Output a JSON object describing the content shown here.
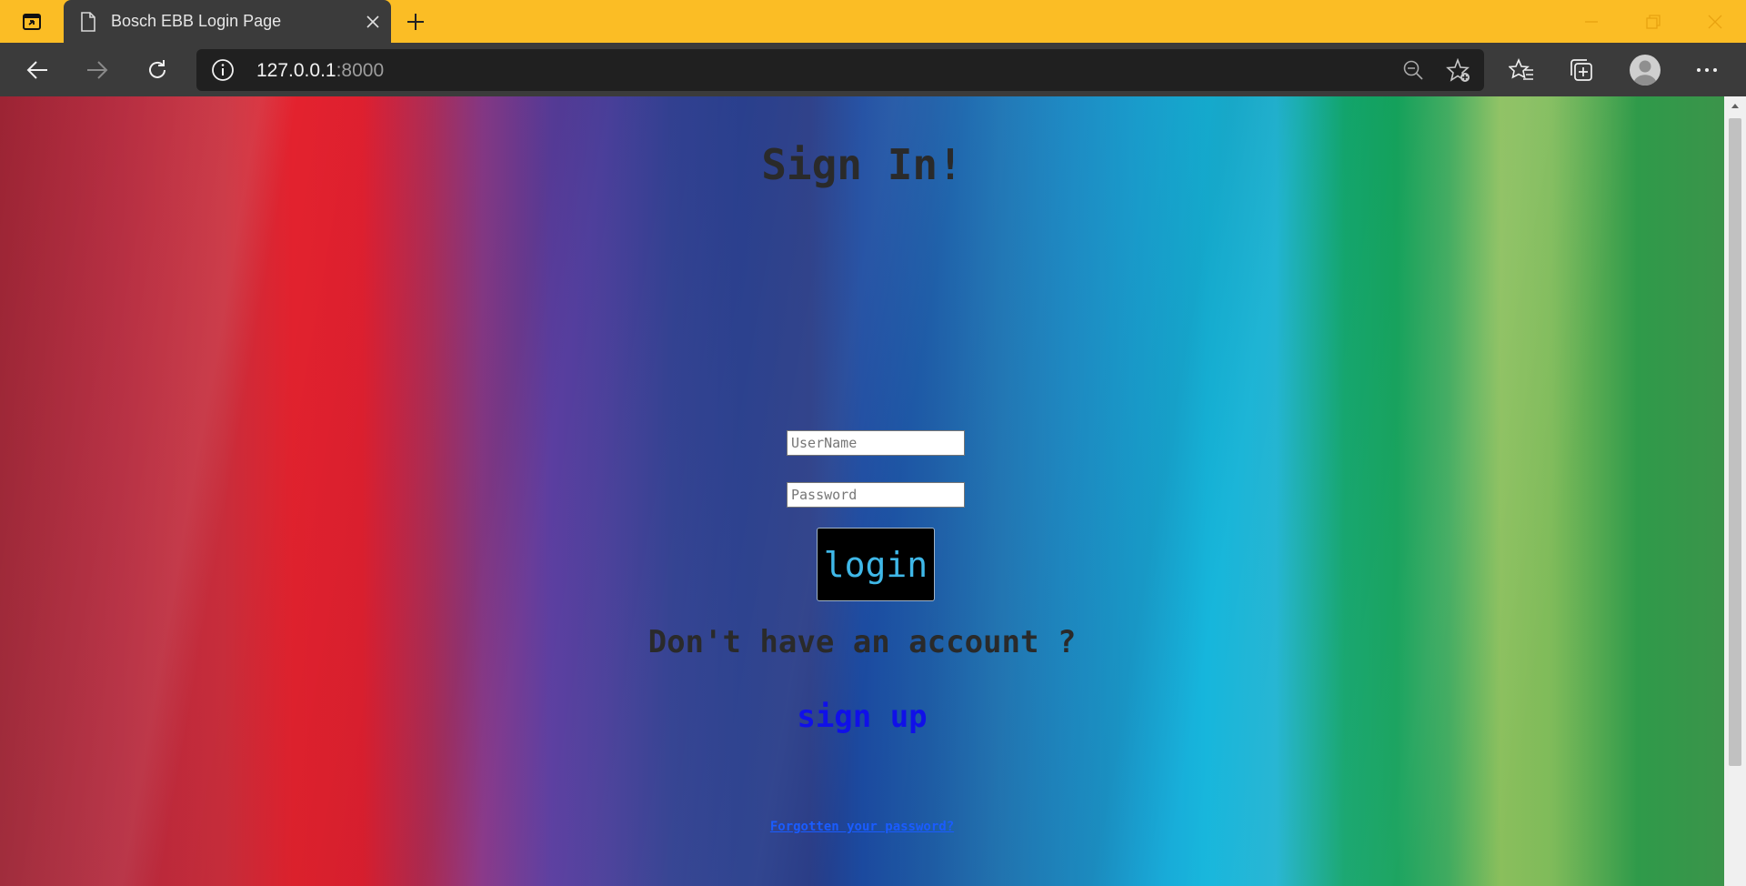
{
  "browser": {
    "tab_title": "Bosch EBB Login Page",
    "url_host": "127.0.0.1",
    "url_port": ":8000",
    "theme_color": "#fbbd25"
  },
  "icons": {
    "tab_actions": "tab-actions-icon",
    "page": "page-icon",
    "close": "close-icon",
    "new_tab": "plus-icon",
    "back": "back-arrow-icon",
    "forward": "forward-arrow-icon",
    "refresh": "refresh-icon",
    "info": "info-icon",
    "zoom": "zoom-out-icon",
    "add_favorite": "star-plus-icon",
    "favorites": "favorites-icon",
    "collections": "collections-icon",
    "profile": "profile-icon",
    "more": "more-icon"
  },
  "page": {
    "heading": "Sign In!",
    "username_placeholder": "UserName",
    "password_placeholder": "Password",
    "login_label": "login",
    "no_account_text": "Don't have an account ?",
    "signup_label": "sign up",
    "forgot_label": "Forgotten your password?"
  },
  "colors": {
    "login_text": "#3fb8e8",
    "signup_link": "#1010e8",
    "forgot_link": "#1a5cff"
  }
}
